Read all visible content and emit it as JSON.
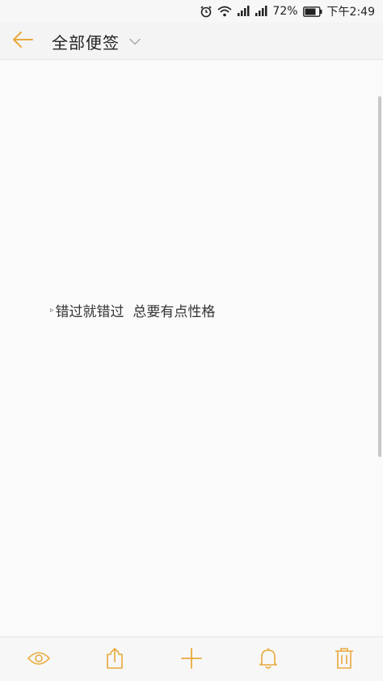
{
  "status_bar": {
    "battery": "72%",
    "time": "下午2:49",
    "icons": [
      "alarm-icon",
      "wifi-icon",
      "signal-icon",
      "signal-icon",
      "battery-icon"
    ]
  },
  "header": {
    "title": "全部便签",
    "back_icon": "arrow-left-icon",
    "dropdown_icon": "chevron-down-icon"
  },
  "note": {
    "marker": "▹",
    "text": "错过就错过  总要有点性格"
  },
  "toolbar": {
    "items": [
      "eye-icon",
      "share-icon",
      "plus-icon",
      "bell-icon",
      "trash-icon"
    ]
  },
  "colors": {
    "accent": "#e8a93a",
    "background": "#fafafa",
    "text": "#333333"
  }
}
